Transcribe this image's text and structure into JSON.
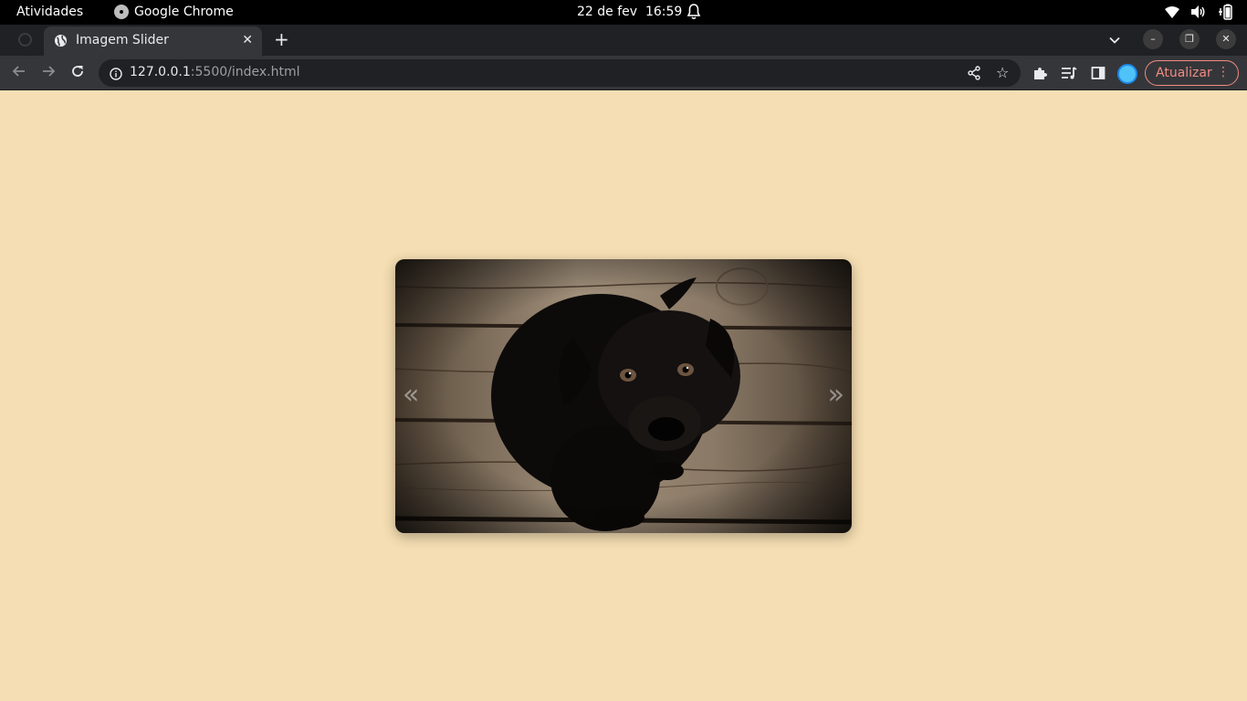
{
  "system": {
    "activities": "Atividades",
    "app_name": "Google Chrome",
    "date": "22 de fev",
    "time": "16:59"
  },
  "browser": {
    "tab_title": "Imagem Slider",
    "url_host": "127.0.0.1",
    "url_rest": ":5500/index.html",
    "update_label": "Atualizar"
  },
  "slider": {
    "prev": "«",
    "next": "»",
    "background": "#f5deb3"
  },
  "icons": [
    "wifi-icon",
    "volume-icon",
    "battery-icon",
    "bell-icon",
    "globe-icon",
    "back-icon",
    "forward-icon",
    "reload-icon",
    "info-icon",
    "share-icon",
    "star-icon",
    "extensions-icon",
    "reading-list-icon",
    "side-panel-icon",
    "menu-dots-icon"
  ]
}
